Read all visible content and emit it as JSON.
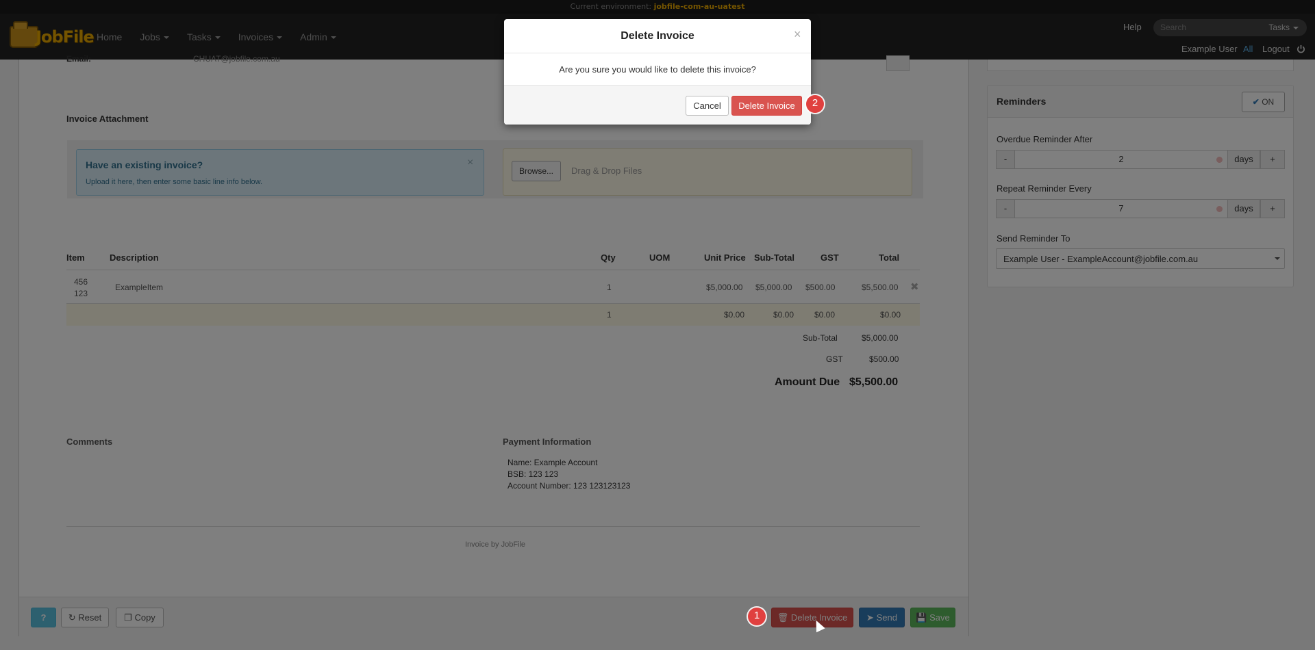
{
  "env": {
    "label": "Current environment:",
    "name": "jobfile-com-au-uatest"
  },
  "nav": {
    "logo_text": "JobFile",
    "links": [
      "Home",
      "Jobs",
      "Tasks",
      "Invoices",
      "Admin"
    ],
    "help": "Help",
    "search_placeholder": "Search",
    "search_scope": "Tasks",
    "user_name": "Example User",
    "all_link": "All",
    "logout": "Logout"
  },
  "invoice": {
    "email_label": "Email:",
    "email_value": "CHUAT@jobfile.com.au",
    "attachment_title": "Invoice Attachment",
    "alert_title": "Have an existing invoice?",
    "alert_text": "Upload it here, then enter some basic line info below.",
    "browse_label": "Browse...",
    "drop_text": "Drag & Drop Files",
    "columns": [
      "Item",
      "Description",
      "Qty",
      "UOM",
      "Unit Price",
      "Sub-Total",
      "GST",
      "Total"
    ],
    "rows": [
      {
        "item_line1": "456",
        "item_line2": "123",
        "description": "ExampleItem",
        "qty": "1",
        "uom": "",
        "unit_price": "$5,000.00",
        "subtotal": "$5,000.00",
        "gst": "$500.00",
        "total": "$5,500.00"
      },
      {
        "item_line1": "",
        "item_line2": "",
        "description": "",
        "qty": "1",
        "uom": "",
        "unit_price": "$0.00",
        "subtotal": "$0.00",
        "gst": "$0.00",
        "total": "$0.00"
      }
    ],
    "summary": {
      "subtotal_label": "Sub-Total",
      "subtotal_value": "$5,000.00",
      "gst_label": "GST",
      "gst_value": "$500.00",
      "amount_due_label": "Amount Due",
      "amount_due_value": "$5,500.00"
    },
    "comments_label": "Comments",
    "payment_label": "Payment Information",
    "payment_lines": [
      "Name: Example Account",
      "BSB: 123 123",
      "Account Number: 123 123123123"
    ],
    "footer_text": "Invoice by JobFile"
  },
  "footer_buttons": {
    "help_symbol": "?",
    "reset": "Reset",
    "copy": "Copy",
    "delete": "Delete Invoice",
    "send": "Send",
    "save": "Save"
  },
  "reminders": {
    "title": "Reminders",
    "toggle": "ON",
    "overdue_label": "Overdue Reminder After",
    "overdue_value": "2",
    "repeat_label": "Repeat Reminder Every",
    "repeat_value": "7",
    "unit": "days",
    "minus": "-",
    "plus": "+",
    "send_to_label": "Send Reminder To",
    "send_to_value": "Example User - ExampleAccount@jobfile.com.au"
  },
  "modal": {
    "title": "Delete Invoice",
    "close": "×",
    "message": "Are you sure you would like to delete this invoice?",
    "cancel": "Cancel",
    "confirm": "Delete Invoice"
  },
  "badges": {
    "step1": "1",
    "step2": "2"
  },
  "colors": {
    "danger": "#d9534f",
    "primary": "#337ab7",
    "success": "#5cb85c",
    "info": "#5bc0de",
    "brand": "#e8a800"
  }
}
